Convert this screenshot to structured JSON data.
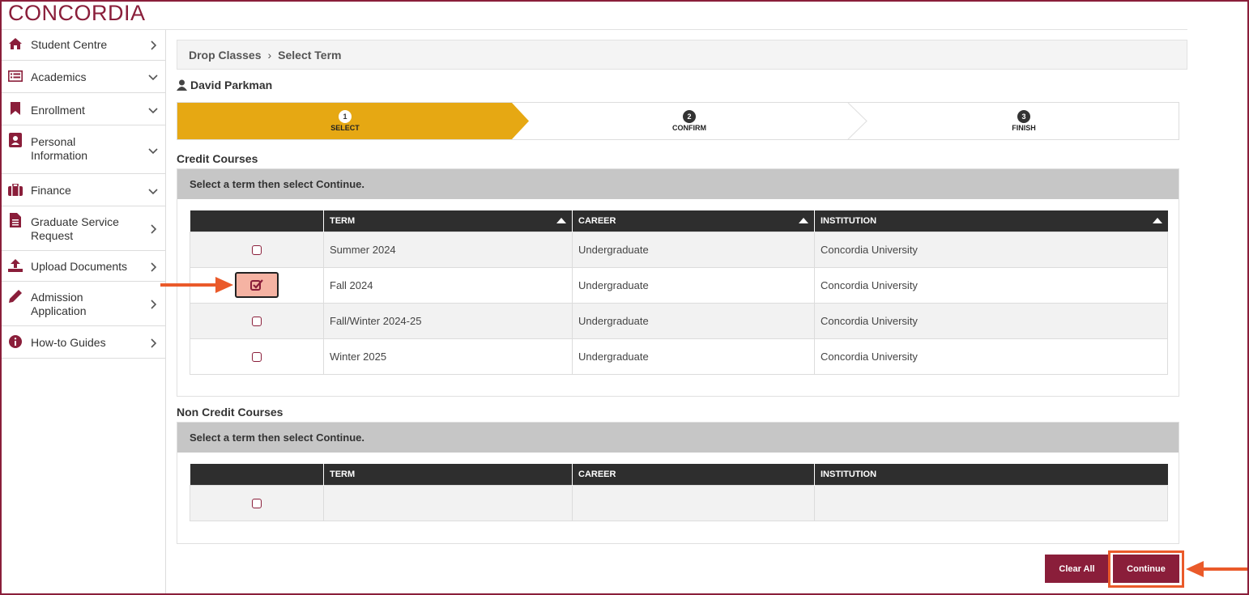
{
  "brand": {
    "logo": "CONCORDIA",
    "color": "#8a1e3a"
  },
  "sidebar": {
    "items": [
      {
        "label": "Student Centre",
        "icon": "home-icon",
        "chevron": "right"
      },
      {
        "label": "Academics",
        "icon": "list-card-icon",
        "chevron": "down"
      },
      {
        "label": "Enrollment",
        "icon": "bookmark-icon",
        "chevron": "down"
      },
      {
        "label": "Personal\nInformation",
        "icon": "id-card-icon",
        "chevron": "down"
      },
      {
        "label": "Finance",
        "icon": "briefcase-icon",
        "chevron": "down"
      },
      {
        "label": "Graduate Service\nRequest",
        "icon": "document-icon",
        "chevron": "right"
      },
      {
        "label": "Upload Documents",
        "icon": "upload-icon",
        "chevron": "right"
      },
      {
        "label": "Admission\nApplication",
        "icon": "pencil-icon",
        "chevron": "right"
      },
      {
        "label": "How-to Guides",
        "icon": "info-icon",
        "chevron": "right"
      }
    ]
  },
  "breadcrumb": {
    "first": "Drop Classes",
    "sep": "›",
    "current": "Select Term"
  },
  "user": {
    "name": "David Parkman"
  },
  "steps": [
    {
      "num": "1",
      "label": "SELECT",
      "active": true
    },
    {
      "num": "2",
      "label": "CONFIRM",
      "active": false
    },
    {
      "num": "3",
      "label": "FINISH",
      "active": false
    }
  ],
  "credit": {
    "title": "Credit Courses",
    "instruction": "Select a term then select Continue.",
    "columns": [
      "TERM",
      "CAREER",
      "INSTITUTION"
    ],
    "rows": [
      {
        "term": "Summer 2024",
        "career": "Undergraduate",
        "institution": "Concordia University",
        "checked": false
      },
      {
        "term": "Fall 2024",
        "career": "Undergraduate",
        "institution": "Concordia University",
        "checked": true
      },
      {
        "term": "Fall/Winter 2024-25",
        "career": "Undergraduate",
        "institution": "Concordia University",
        "checked": false
      },
      {
        "term": "Winter 2025",
        "career": "Undergraduate",
        "institution": "Concordia University",
        "checked": false
      }
    ]
  },
  "noncredit": {
    "title": "Non Credit Courses",
    "instruction": "Select a term then select Continue.",
    "columns": [
      "TERM",
      "CAREER",
      "INSTITUTION"
    ]
  },
  "buttons": {
    "clear_all": "Clear All",
    "continue": "Continue"
  },
  "colors": {
    "accent": "#8a1e3a",
    "step_active": "#e6a813",
    "annotation": "#ea5a2a"
  }
}
